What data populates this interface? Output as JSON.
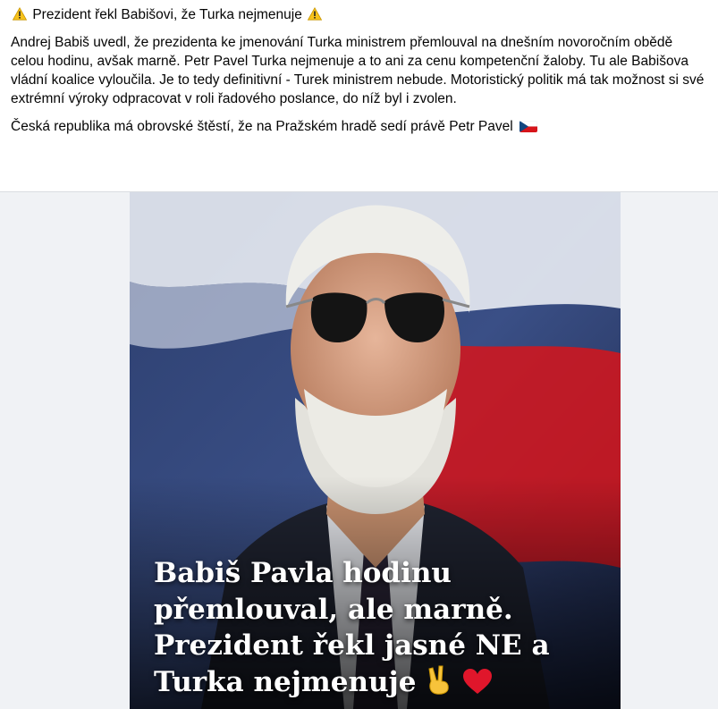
{
  "post": {
    "title": "Prezident řekl Babišovi, že Turka nejmenuje",
    "paragraph1": "Andrej Babiš uvedl, že prezidenta ke jmenování Turka ministrem přemlouval na dnešním novoročním obědě celou hodinu, avšak marně. Petr Pavel Turka nejmenuje a to ani za cenu kompetenční žaloby. Tu ale Babišova vládní koalice vyloučila. Je to tedy definitivní - Turek ministrem nebude. Motoristický politik má tak možnost si své extrémní výroky odpracovat v roli řadového poslance, do níž byl i zvolen.",
    "paragraph2": "Česká republika má obrovské štěstí, že na Pražském hradě sedí právě Petr Pavel",
    "icons": [
      "warning-icon",
      "czech-flag-icon"
    ]
  },
  "image": {
    "caption_lines": [
      "Babiš Pavla hodinu",
      "přemlouval, ale marně.",
      "Prezident řekl jasné NE a",
      "Turka nejmenuje"
    ],
    "caption_icons": [
      "victory-hand-icon",
      "red-heart-icon"
    ],
    "colors": {
      "flag_blue": "#11457E",
      "flag_red": "#D7141A",
      "flag_white": "#FFFFFF"
    }
  }
}
